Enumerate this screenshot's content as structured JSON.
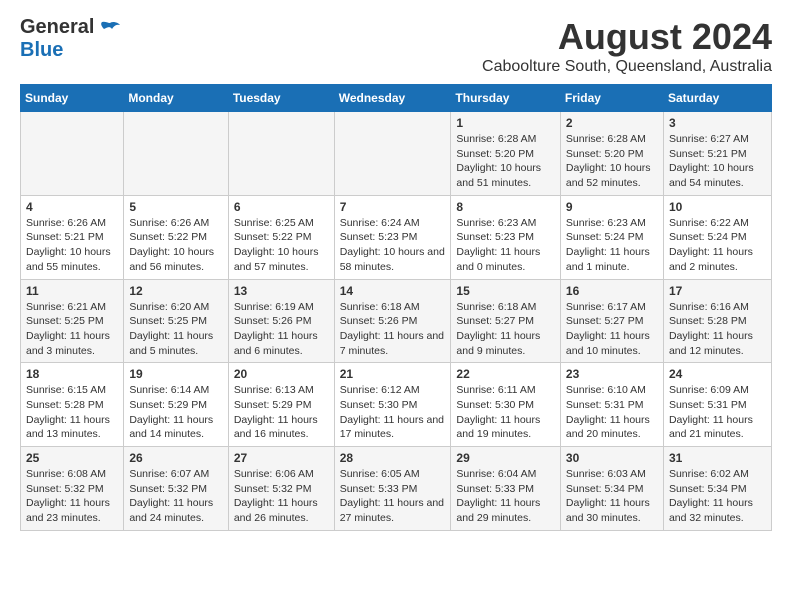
{
  "logo": {
    "general": "General",
    "blue": "Blue"
  },
  "title": "August 2024",
  "subtitle": "Caboolture South, Queensland, Australia",
  "weekdays": [
    "Sunday",
    "Monday",
    "Tuesday",
    "Wednesday",
    "Thursday",
    "Friday",
    "Saturday"
  ],
  "weeks": [
    [
      {
        "day": "",
        "content": ""
      },
      {
        "day": "",
        "content": ""
      },
      {
        "day": "",
        "content": ""
      },
      {
        "day": "",
        "content": ""
      },
      {
        "day": "1",
        "content": "Sunrise: 6:28 AM\nSunset: 5:20 PM\nDaylight: 10 hours and 51 minutes."
      },
      {
        "day": "2",
        "content": "Sunrise: 6:28 AM\nSunset: 5:20 PM\nDaylight: 10 hours and 52 minutes."
      },
      {
        "day": "3",
        "content": "Sunrise: 6:27 AM\nSunset: 5:21 PM\nDaylight: 10 hours and 54 minutes."
      }
    ],
    [
      {
        "day": "4",
        "content": "Sunrise: 6:26 AM\nSunset: 5:21 PM\nDaylight: 10 hours and 55 minutes."
      },
      {
        "day": "5",
        "content": "Sunrise: 6:26 AM\nSunset: 5:22 PM\nDaylight: 10 hours and 56 minutes."
      },
      {
        "day": "6",
        "content": "Sunrise: 6:25 AM\nSunset: 5:22 PM\nDaylight: 10 hours and 57 minutes."
      },
      {
        "day": "7",
        "content": "Sunrise: 6:24 AM\nSunset: 5:23 PM\nDaylight: 10 hours and 58 minutes."
      },
      {
        "day": "8",
        "content": "Sunrise: 6:23 AM\nSunset: 5:23 PM\nDaylight: 11 hours and 0 minutes."
      },
      {
        "day": "9",
        "content": "Sunrise: 6:23 AM\nSunset: 5:24 PM\nDaylight: 11 hours and 1 minute."
      },
      {
        "day": "10",
        "content": "Sunrise: 6:22 AM\nSunset: 5:24 PM\nDaylight: 11 hours and 2 minutes."
      }
    ],
    [
      {
        "day": "11",
        "content": "Sunrise: 6:21 AM\nSunset: 5:25 PM\nDaylight: 11 hours and 3 minutes."
      },
      {
        "day": "12",
        "content": "Sunrise: 6:20 AM\nSunset: 5:25 PM\nDaylight: 11 hours and 5 minutes."
      },
      {
        "day": "13",
        "content": "Sunrise: 6:19 AM\nSunset: 5:26 PM\nDaylight: 11 hours and 6 minutes."
      },
      {
        "day": "14",
        "content": "Sunrise: 6:18 AM\nSunset: 5:26 PM\nDaylight: 11 hours and 7 minutes."
      },
      {
        "day": "15",
        "content": "Sunrise: 6:18 AM\nSunset: 5:27 PM\nDaylight: 11 hours and 9 minutes."
      },
      {
        "day": "16",
        "content": "Sunrise: 6:17 AM\nSunset: 5:27 PM\nDaylight: 11 hours and 10 minutes."
      },
      {
        "day": "17",
        "content": "Sunrise: 6:16 AM\nSunset: 5:28 PM\nDaylight: 11 hours and 12 minutes."
      }
    ],
    [
      {
        "day": "18",
        "content": "Sunrise: 6:15 AM\nSunset: 5:28 PM\nDaylight: 11 hours and 13 minutes."
      },
      {
        "day": "19",
        "content": "Sunrise: 6:14 AM\nSunset: 5:29 PM\nDaylight: 11 hours and 14 minutes."
      },
      {
        "day": "20",
        "content": "Sunrise: 6:13 AM\nSunset: 5:29 PM\nDaylight: 11 hours and 16 minutes."
      },
      {
        "day": "21",
        "content": "Sunrise: 6:12 AM\nSunset: 5:30 PM\nDaylight: 11 hours and 17 minutes."
      },
      {
        "day": "22",
        "content": "Sunrise: 6:11 AM\nSunset: 5:30 PM\nDaylight: 11 hours and 19 minutes."
      },
      {
        "day": "23",
        "content": "Sunrise: 6:10 AM\nSunset: 5:31 PM\nDaylight: 11 hours and 20 minutes."
      },
      {
        "day": "24",
        "content": "Sunrise: 6:09 AM\nSunset: 5:31 PM\nDaylight: 11 hours and 21 minutes."
      }
    ],
    [
      {
        "day": "25",
        "content": "Sunrise: 6:08 AM\nSunset: 5:32 PM\nDaylight: 11 hours and 23 minutes."
      },
      {
        "day": "26",
        "content": "Sunrise: 6:07 AM\nSunset: 5:32 PM\nDaylight: 11 hours and 24 minutes."
      },
      {
        "day": "27",
        "content": "Sunrise: 6:06 AM\nSunset: 5:32 PM\nDaylight: 11 hours and 26 minutes."
      },
      {
        "day": "28",
        "content": "Sunrise: 6:05 AM\nSunset: 5:33 PM\nDaylight: 11 hours and 27 minutes."
      },
      {
        "day": "29",
        "content": "Sunrise: 6:04 AM\nSunset: 5:33 PM\nDaylight: 11 hours and 29 minutes."
      },
      {
        "day": "30",
        "content": "Sunrise: 6:03 AM\nSunset: 5:34 PM\nDaylight: 11 hours and 30 minutes."
      },
      {
        "day": "31",
        "content": "Sunrise: 6:02 AM\nSunset: 5:34 PM\nDaylight: 11 hours and 32 minutes."
      }
    ]
  ]
}
